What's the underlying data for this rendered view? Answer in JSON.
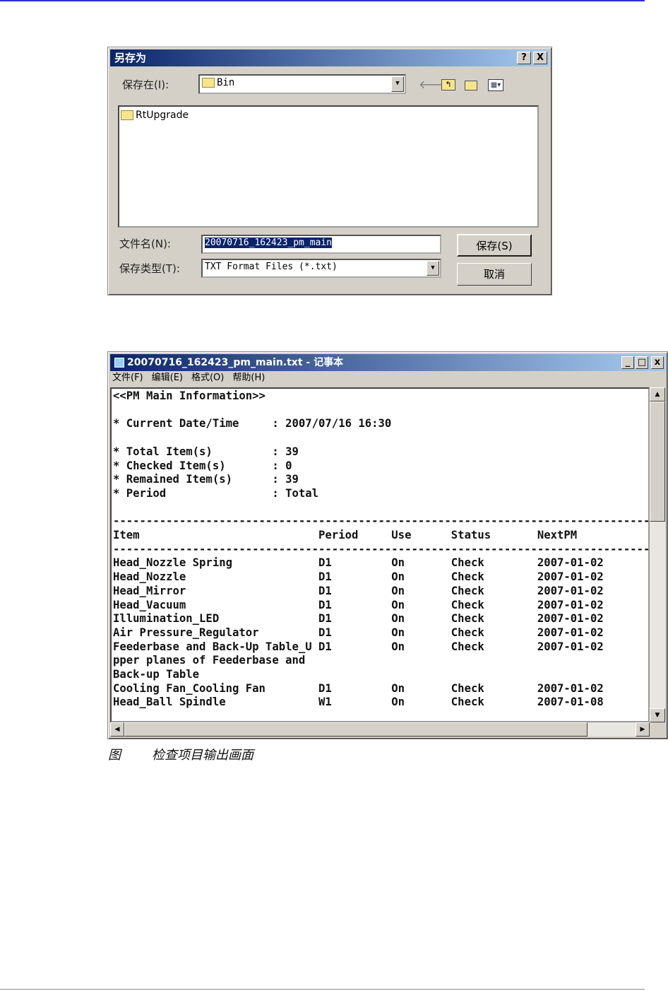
{
  "save_dialog": {
    "title": "另存为",
    "help": "?",
    "close": "X",
    "save_in_label": "保存在(I):",
    "save_in_value": "Bin",
    "files": [
      "RtUpgrade"
    ],
    "filename_label": "文件名(N):",
    "filename_value": "20070716_162423_pm_main",
    "type_label": "保存类型(T):",
    "type_value": "TXT Format Files (*.txt)",
    "save_button": "保存(S)",
    "cancel_button": "取消"
  },
  "notepad": {
    "title": "20070716_162423_pm_main.txt - 记事本",
    "menu": [
      "文件(F)",
      "编辑(E)",
      "格式(O)",
      "帮助(H)"
    ],
    "heading": "<<PM Main Information>>",
    "info": [
      {
        "label": "* Current Date/Time",
        "value": ": 2007/07/16 16:30"
      },
      {
        "label": "* Total Item(s)",
        "value": ": 39"
      },
      {
        "label": "* Checked Item(s)",
        "value": ": 0"
      },
      {
        "label": "* Remained Item(s)",
        "value": ": 39"
      },
      {
        "label": "* Period",
        "value": ": Total"
      }
    ],
    "separator": "------------------------------------------------------------------------------------",
    "columns": [
      "Item",
      "Period",
      "Use",
      "Status",
      "NextPM"
    ],
    "rows": [
      {
        "item": "Head_Nozzle Spring",
        "period": "D1",
        "use": "On",
        "status": "Check",
        "next": "2007-01-02"
      },
      {
        "item": "Head_Nozzle",
        "period": "D1",
        "use": "On",
        "status": "Check",
        "next": "2007-01-02"
      },
      {
        "item": "Head_Mirror",
        "period": "D1",
        "use": "On",
        "status": "Check",
        "next": "2007-01-02"
      },
      {
        "item": "Head_Vacuum",
        "period": "D1",
        "use": "On",
        "status": "Check",
        "next": "2007-01-02"
      },
      {
        "item": "Illumination_LED",
        "period": "D1",
        "use": "On",
        "status": "Check",
        "next": "2007-01-02"
      },
      {
        "item": "Air Pressure_Regulator",
        "period": "D1",
        "use": "On",
        "status": "Check",
        "next": "2007-01-02"
      },
      {
        "item": "Feederbase and Back-Up Table_U",
        "period": "D1",
        "use": "On",
        "status": "Check",
        "next": "2007-01-02"
      },
      {
        "item": "pper planes of Feederbase and",
        "period": "",
        "use": "",
        "status": "",
        "next": ""
      },
      {
        "item": "Back-up Table",
        "period": "",
        "use": "",
        "status": "",
        "next": ""
      },
      {
        "item": "Cooling Fan_Cooling Fan",
        "period": "D1",
        "use": "On",
        "status": "Check",
        "next": "2007-01-02"
      },
      {
        "item": "Head_Ball Spindle",
        "period": "W1",
        "use": "On",
        "status": "Check",
        "next": "2007-01-08"
      }
    ]
  },
  "caption": {
    "fig": "图",
    "text": "检查项目输出画面"
  }
}
